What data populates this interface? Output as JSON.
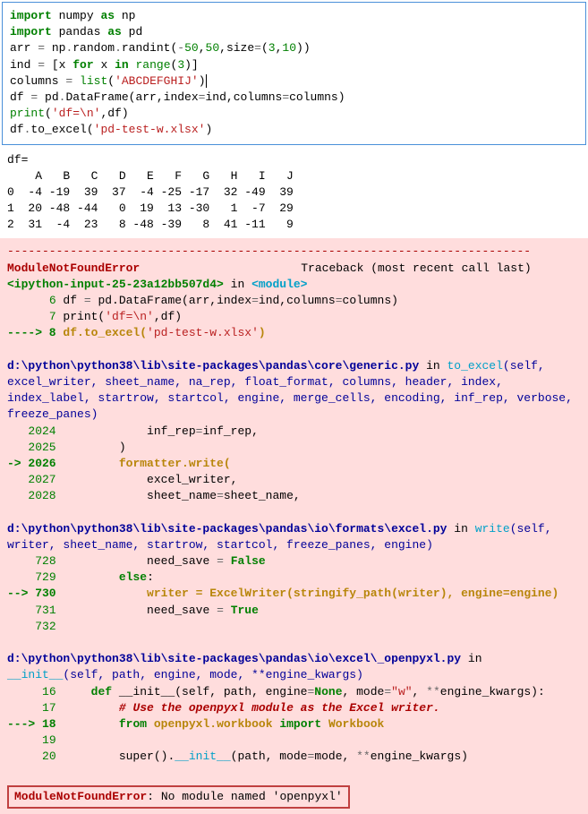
{
  "code": {
    "l1": {
      "kw": "import",
      "mod": "numpy",
      "as": "as",
      "alias": "np"
    },
    "l2": {
      "kw": "import",
      "mod": "pandas",
      "as": "as",
      "alias": "pd"
    },
    "l3": "arr = np.random.randint(-50,50,size=(3,10))",
    "l4": "ind = [x for x in range(3)]",
    "l5": "columns = list('ABCDEFGHIJ')",
    "l6": "df = pd.DataFrame(arr,index=ind,columns=columns)",
    "l7": "print('df=\\n',df)",
    "l8": "df.to_excel('pd-test-w.xlsx')"
  },
  "output": {
    "header": "df=",
    "cols": "    A   B   C   D   E   F   G   H   I   J",
    "row0": "0  -4 -19  39  37  -4 -25 -17  32 -49  39",
    "row1": "1  20 -48 -44   0  19  13 -30   1  -7  29",
    "row2": "2  31  -4  23   8 -48 -39   8  41 -11   9"
  },
  "chart_data": {
    "type": "table",
    "columns": [
      "A",
      "B",
      "C",
      "D",
      "E",
      "F",
      "G",
      "H",
      "I",
      "J"
    ],
    "index": [
      0,
      1,
      2
    ],
    "data": [
      [
        -4,
        -19,
        39,
        37,
        -4,
        -25,
        -17,
        32,
        -49,
        39
      ],
      [
        20,
        -48,
        -44,
        0,
        19,
        13,
        -30,
        1,
        -7,
        29
      ],
      [
        31,
        -4,
        23,
        8,
        -48,
        -39,
        8,
        41,
        -11,
        9
      ]
    ]
  },
  "traceback": {
    "dash": "---------------------------------------------------------------------------",
    "errname": "ModuleNotFoundError",
    "tb_label": "Traceback (most recent call last)",
    "frame0": {
      "head_pre": "<ipython-input-25-23a12bb507d4>",
      "head_in": " in ",
      "head_mod": "<module>",
      "l6": "      6 df = pd.DataFrame(arr,index=ind,columns=columns)",
      "l7a": "      7 print(",
      "l7b": "'df=\\n'",
      "l7c": ",df)",
      "l8a": "----> 8 ",
      "l8b": "df.to_excel(",
      "l8c": "'pd-test-w.xlsx'",
      "l8d": ")"
    },
    "frame1": {
      "path": "d:\\python\\python38\\lib\\site-packages\\pandas\\core\\generic.py",
      "in": " in ",
      "fn": "to_excel",
      "sig": "(self, excel_writer, sheet_name, na_rep, float_format, columns, header, index, index_label, startrow, startcol, engine, merge_cells, encoding, inf_rep, verbose, freeze_panes)",
      "l2024": "   2024             inf_rep=inf_rep,",
      "l2025": "   2025         )",
      "l2026a": "-> 2026         ",
      "l2026b": "formatter.write(",
      "l2027": "   2027             excel_writer,",
      "l2028": "   2028             sheet_name=sheet_name,"
    },
    "frame2": {
      "path": "d:\\python\\python38\\lib\\site-packages\\pandas\\io\\formats\\excel.py",
      "in": " in ",
      "fn": "write",
      "sig": "(self, writer, sheet_name, startrow, startcol, freeze_panes, engine)",
      "l728a": "    728             need_save = ",
      "l728b": "False",
      "l729a": "    729         ",
      "l729b": "else",
      "l729c": ":",
      "l730a": "--> 730             ",
      "l730b": "writer = ExcelWriter(stringify_path(writer), engine=engine)",
      "l731a": "    731             need_save = ",
      "l731b": "True",
      "l732": "    732 "
    },
    "frame3": {
      "path": "d:\\python\\python38\\lib\\site-packages\\pandas\\io\\excel\\_openpyxl.py",
      "in": " in ",
      "fn": "__init__",
      "sig": "(self, path, engine, mode, **engine_kwargs)",
      "l16a": "     16     ",
      "l16b": "def",
      "l16c": " __init__(self, path, engine=",
      "l16d": "None",
      "l16e": ", mode=",
      "l16f": "\"w\"",
      "l16g": ", **engine_kwargs):",
      "l17a": "     17         ",
      "l17b": "# Use the openpyxl module as the Excel writer.",
      "l18a": "---> 18         ",
      "l18b": "from",
      "l18c": " openpyxl.workbook ",
      "l18d": "import",
      "l18e": " Workbook",
      "l19": "     19 ",
      "l20a": "     20         super().",
      "l20b": "__init__",
      "l20c": "(path, mode=mode, **engine_kwargs)"
    },
    "final": {
      "name": "ModuleNotFoundError",
      "msg": ": No module named 'openpyxl'"
    }
  }
}
